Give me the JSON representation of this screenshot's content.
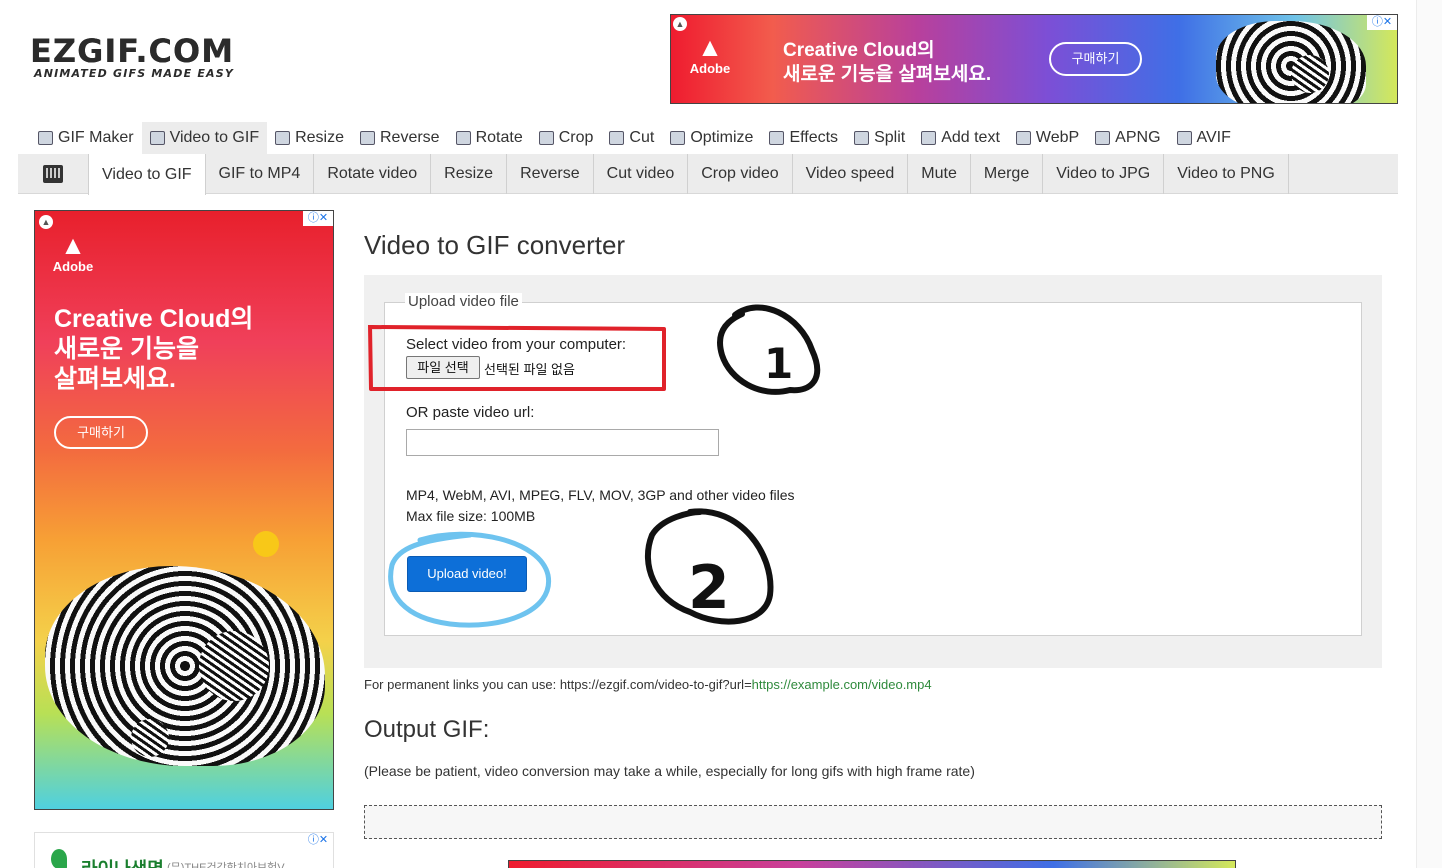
{
  "logo": {
    "main": "EZGIF.COM",
    "tagline": "ANIMATED GIFS MADE EASY"
  },
  "top_ad": {
    "brand": "Adobe",
    "headline_line1": "Creative Cloud의",
    "headline_line2": "새로운 기능을 살펴보세요.",
    "button": "구매하기"
  },
  "main_nav": [
    {
      "label": "GIF Maker",
      "icon": "gif-maker-icon"
    },
    {
      "label": "Video to GIF",
      "icon": "video-icon"
    },
    {
      "label": "Resize",
      "icon": "resize-icon"
    },
    {
      "label": "Reverse",
      "icon": "reverse-icon"
    },
    {
      "label": "Rotate",
      "icon": "rotate-icon"
    },
    {
      "label": "Crop",
      "icon": "crop-icon"
    },
    {
      "label": "Cut",
      "icon": "cut-icon"
    },
    {
      "label": "Optimize",
      "icon": "optimize-icon"
    },
    {
      "label": "Effects",
      "icon": "effects-icon"
    },
    {
      "label": "Split",
      "icon": "split-icon"
    },
    {
      "label": "Add text",
      "icon": "add-text-icon"
    },
    {
      "label": "WebP",
      "icon": "webp-icon"
    },
    {
      "label": "APNG",
      "icon": "apng-icon"
    },
    {
      "label": "AVIF",
      "icon": "avif-icon"
    }
  ],
  "sub_nav": [
    "Video to GIF",
    "GIF to MP4",
    "Rotate video",
    "Resize",
    "Reverse",
    "Cut video",
    "Crop video",
    "Video speed",
    "Mute",
    "Merge",
    "Video to JPG",
    "Video to PNG"
  ],
  "left_ad": {
    "brand": "Adobe",
    "headline_line1": "Creative Cloud의",
    "headline_line2": "새로운 기능을",
    "headline_line3": "살펴보세요.",
    "button": "구매하기"
  },
  "left_ad2": {
    "title": "라이나생명",
    "subtitle": "(무)THE건강한치아보험V"
  },
  "content": {
    "title": "Video to GIF converter",
    "legend": "Upload video file",
    "select_label": "Select video from your computer:",
    "file_button": "파일 선택",
    "file_status": "선택된 파일 없음",
    "url_label": "OR paste video url:",
    "url_value": "",
    "formats": "MP4, WebM, AVI, MPEG, FLV, MOV, 3GP and other video files",
    "max_size": "Max file size: 100MB",
    "upload_button": "Upload video!",
    "perm_prefix": "For permanent links you can use: https://ezgif.com/video-to-gif?url=",
    "perm_link": "https://example.com/video.mp4",
    "output_title": "Output GIF:",
    "output_note": "(Please be patient, video conversion may take a while, especially for long gifs with high frame rate)"
  },
  "annotations": {
    "step1": "1",
    "step2": "2"
  },
  "colors": {
    "upload_button": "#0d6fd8",
    "annotation_red": "#e0222a",
    "annotation_blue": "#6ec3ef",
    "link_green": "#2f8a3c"
  }
}
